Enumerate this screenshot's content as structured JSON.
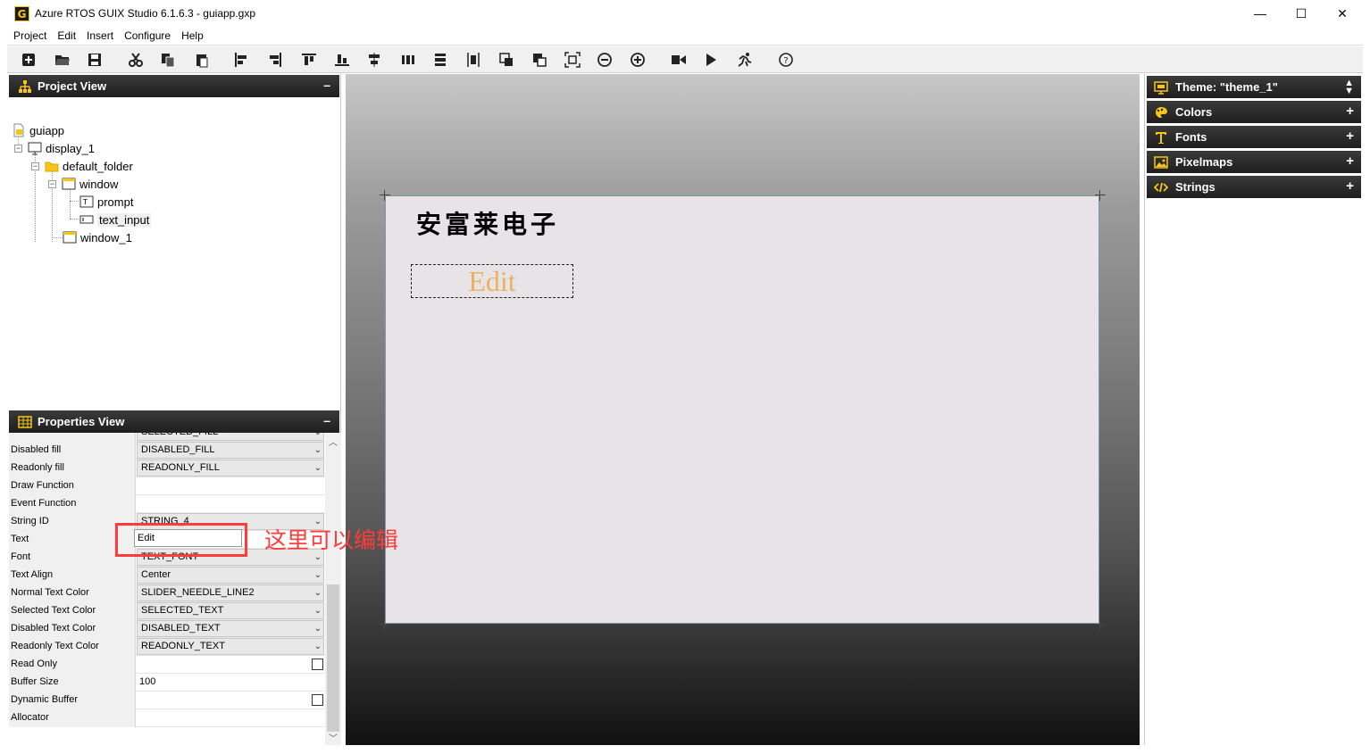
{
  "window": {
    "title": "Azure RTOS GUIX Studio 6.1.6.3 - guiapp.gxp",
    "logo": "G",
    "minimize": "—",
    "maximize": "☐",
    "close": "✕"
  },
  "menu": [
    "Project",
    "Edit",
    "Insert",
    "Configure",
    "Help"
  ],
  "toolbar": {
    "icons": [
      "new-project",
      "open-folder",
      "save",
      "cut",
      "copy",
      "paste",
      "align-left",
      "align-right",
      "align-top",
      "align-bottom",
      "align-center-h",
      "distribute-h",
      "distribute-v",
      "align-center-v",
      "bring-front",
      "send-back",
      "fit-screen",
      "zoom-out",
      "zoom-in",
      "record",
      "run",
      "run-app",
      "help"
    ]
  },
  "project_view": {
    "title": "Project View",
    "collapse": "–",
    "tree": [
      {
        "label": "guiapp"
      },
      {
        "label": "display_1"
      },
      {
        "label": "default_folder"
      },
      {
        "label": "window"
      },
      {
        "label": "prompt"
      },
      {
        "label": "text_input"
      },
      {
        "label": "window_1"
      }
    ]
  },
  "properties_view": {
    "title": "Properties View",
    "collapse": "–",
    "rows": [
      {
        "label": "",
        "value": "SELECTED_FILL",
        "type": "combo"
      },
      {
        "label": "Disabled fill",
        "value": "DISABLED_FILL",
        "type": "combo"
      },
      {
        "label": "Readonly fill",
        "value": "READONLY_FILL",
        "type": "combo"
      },
      {
        "label": "Draw Function",
        "value": "",
        "type": "text"
      },
      {
        "label": "Event Function",
        "value": "",
        "type": "text"
      },
      {
        "label": "String ID",
        "value": "STRING_4",
        "type": "combo"
      },
      {
        "label": "Text",
        "value": "Edit",
        "type": "text"
      },
      {
        "label": "Font",
        "value": "TEXT_FONT",
        "type": "combo"
      },
      {
        "label": "Text Align",
        "value": "Center",
        "type": "combo"
      },
      {
        "label": "Normal Text Color",
        "value": "SLIDER_NEEDLE_LINE2",
        "type": "combo"
      },
      {
        "label": "Selected Text Color",
        "value": "SELECTED_TEXT",
        "type": "combo"
      },
      {
        "label": "Disabled Text Color",
        "value": "DISABLED_TEXT",
        "type": "combo"
      },
      {
        "label": "Readonly Text Color",
        "value": "READONLY_TEXT",
        "type": "combo"
      },
      {
        "label": "Read Only",
        "value": "",
        "type": "check"
      },
      {
        "label": "Buffer Size",
        "value": "100",
        "type": "text"
      },
      {
        "label": "Dynamic Buffer",
        "value": "",
        "type": "check"
      },
      {
        "label": "Allocator",
        "value": "",
        "type": "text"
      }
    ]
  },
  "canvas": {
    "prompt_text": "安富莱电子",
    "edit_text": "Edit"
  },
  "right_panel": {
    "theme": "Theme: \"theme_1\"",
    "sections": [
      "Colors",
      "Fonts",
      "Pixelmaps",
      "Strings"
    ],
    "plus": "+"
  },
  "annotation": {
    "text": "这里可以编辑"
  },
  "colors": {
    "accent_red": "#ff3b3b",
    "edit_text": "#e8b35c",
    "header_dark": "#1e1e1e",
    "icon_yellow": "#f5c518"
  }
}
